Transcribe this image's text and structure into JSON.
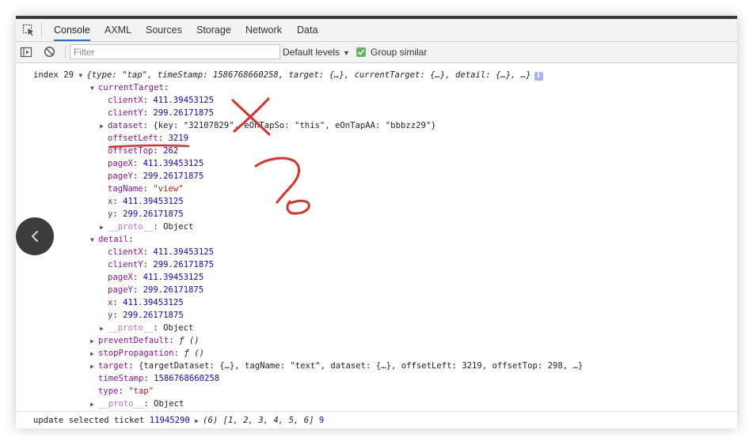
{
  "tabs": [
    {
      "label": "Console",
      "active": true
    },
    {
      "label": "AXML"
    },
    {
      "label": "Sources"
    },
    {
      "label": "Storage"
    },
    {
      "label": "Network"
    },
    {
      "label": "Data"
    }
  ],
  "toolbar": {
    "filter_placeholder": "Filter",
    "levels_label": "Default levels",
    "group_similar_label": "Group similar",
    "group_similar_checked": true
  },
  "console": {
    "line1": {
      "prefix": "index 29",
      "summary": "{type: \"tap\", timeStamp: 1586768660258, target: {…}, currentTarget: {…}, detail: {…}, …}"
    },
    "currentTarget": {
      "label": "currentTarget",
      "clientX": "411.39453125",
      "clientY": "299.26171875",
      "dataset": "{key: \"32107829\", eOnTapSo: \"this\", eOnTapAA: \"bbbzz29\"}",
      "offsetLeft": "3219",
      "offsetTop": "262",
      "pageX": "411.39453125",
      "pageY": "299.26171875",
      "tagName": "\"view\"",
      "x": "411.39453125",
      "y": "299.26171875",
      "proto": "Object"
    },
    "detail": {
      "label": "detail",
      "clientX": "411.39453125",
      "clientY": "299.26171875",
      "pageX": "411.39453125",
      "pageY": "299.26171875",
      "x": "411.39453125",
      "y": "299.26171875",
      "proto": "Object"
    },
    "preventDefault": "ƒ ()",
    "stopPropagation": "ƒ ()",
    "target": "{targetDataset: {…}, tagName: \"text\", dataset: {…}, offsetLeft: 3219, offsetTop: 298, …}",
    "timeStamp": "1586768660258",
    "type": "\"tap\"",
    "proto": "Object",
    "bottom": {
      "text": "update selected ticket",
      "ticket": "11945290",
      "array": "(6) [1, 2, 3, 4, 5, 6]",
      "count": "9"
    }
  },
  "colors": {
    "key": "#881391",
    "string": "#c41a16",
    "number": "#1c00cf",
    "annotation": "#d9312b",
    "active_tab": "#1a73e8"
  }
}
